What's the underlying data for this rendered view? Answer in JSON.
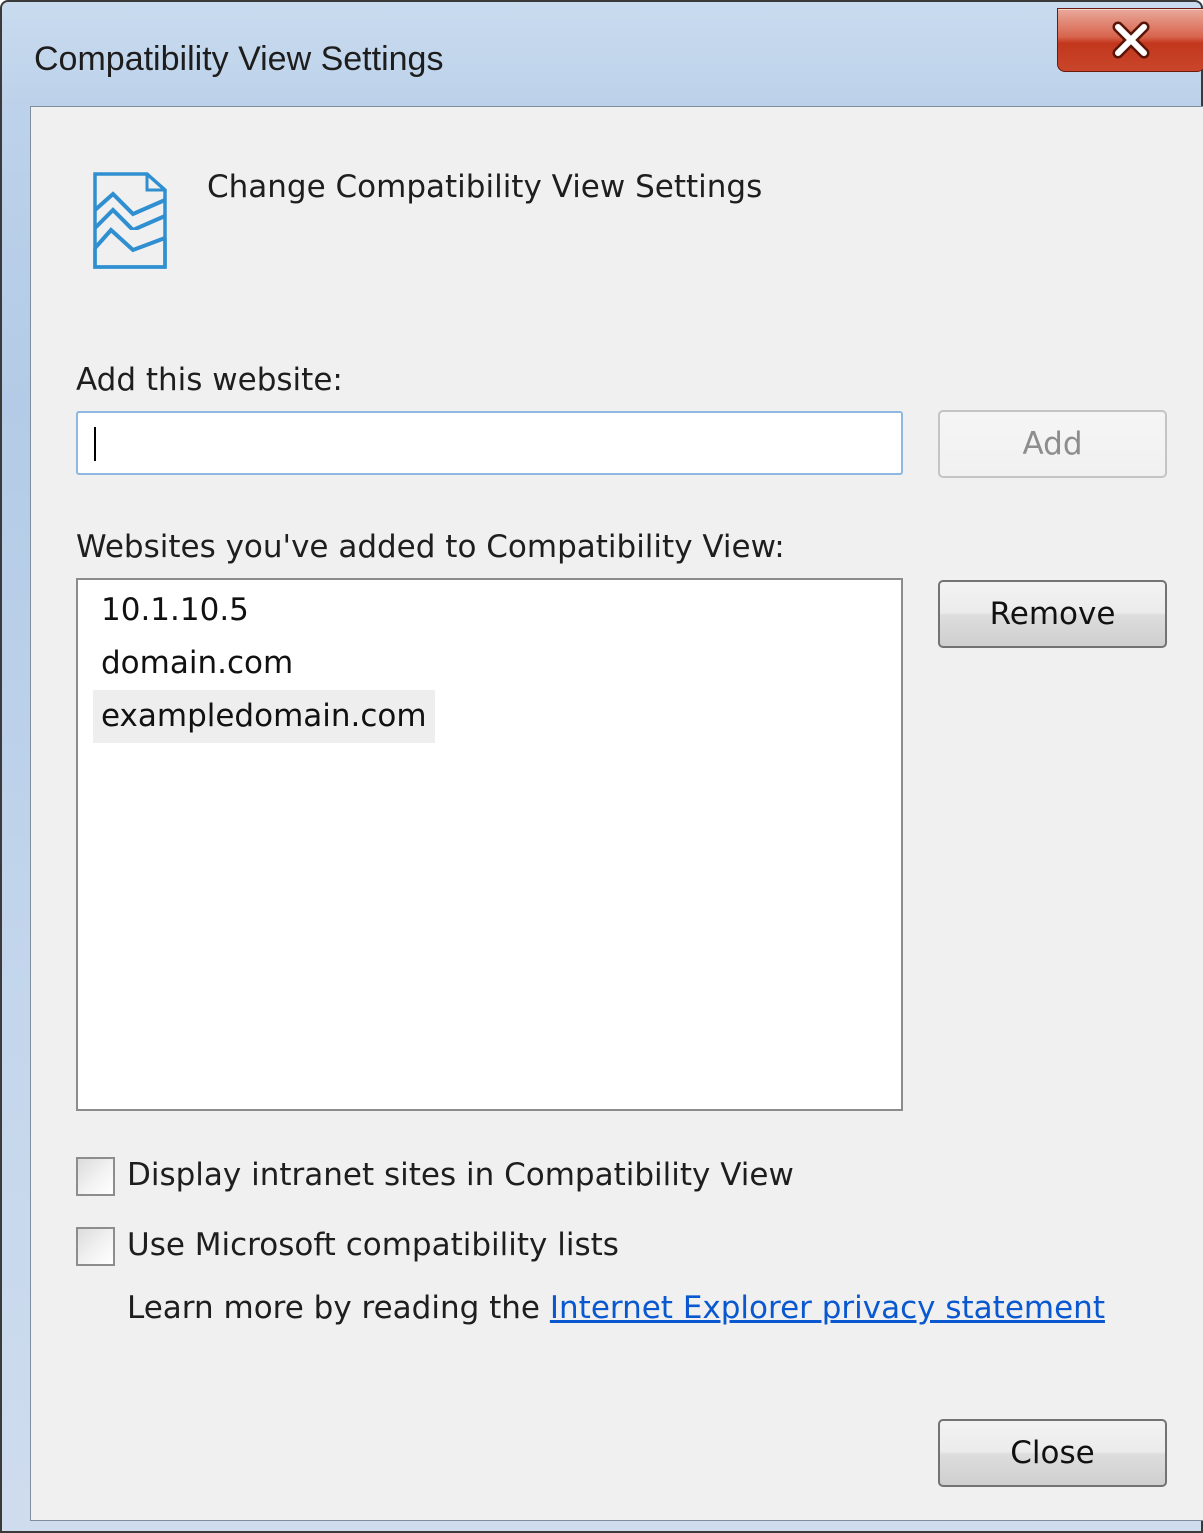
{
  "window": {
    "title": "Compatibility View Settings",
    "close_icon": "close-icon"
  },
  "header": {
    "icon": "compatibility-view-icon",
    "text": "Change Compatibility View Settings"
  },
  "add_website": {
    "label": "Add this website:",
    "input_value": "",
    "add_button": "Add"
  },
  "websites": {
    "label": "Websites you've added to Compatibility View:",
    "items": [
      "10.1.10.5",
      "domain.com",
      "exampledomain.com"
    ],
    "selected": "exampledomain.com",
    "remove_button": "Remove"
  },
  "options": {
    "intranet": {
      "label": "Display intranet sites in Compatibility View",
      "checked": false
    },
    "ms_lists": {
      "label": "Use Microsoft compatibility lists",
      "checked": false
    }
  },
  "privacy": {
    "prefix": "Learn more by reading the",
    "link": "Internet Explorer privacy statement"
  },
  "footer": {
    "close_button": "Close"
  },
  "colors": {
    "link": "#0a58d0",
    "close_button_red": "#c9462a",
    "icon_blue": "#2f8fd0"
  }
}
